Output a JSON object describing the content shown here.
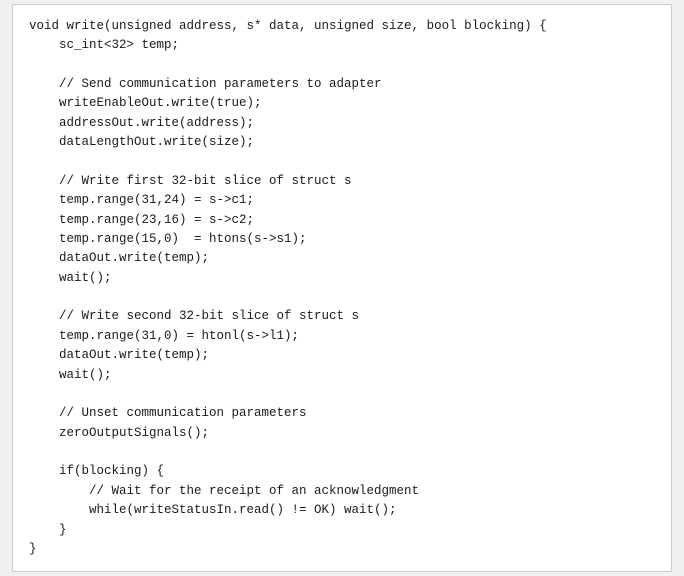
{
  "code": {
    "lines": [
      "void write(unsigned address, s* data, unsigned size, bool blocking) {",
      "    sc_int<32> temp;",
      "",
      "    // Send communication parameters to adapter",
      "    writeEnableOut.write(true);",
      "    addressOut.write(address);",
      "    dataLengthOut.write(size);",
      "",
      "    // Write first 32-bit slice of struct s",
      "    temp.range(31,24) = s->c1;",
      "    temp.range(23,16) = s->c2;",
      "    temp.range(15,0)  = htons(s->s1);",
      "    dataOut.write(temp);",
      "    wait();",
      "",
      "    // Write second 32-bit slice of struct s",
      "    temp.range(31,0) = htonl(s->l1);",
      "    dataOut.write(temp);",
      "    wait();",
      "",
      "    // Unset communication parameters",
      "    zeroOutputSignals();",
      "",
      "    if(blocking) {",
      "        // Wait for the receipt of an acknowledgment",
      "        while(writeStatusIn.read() != OK) wait();",
      "    }",
      "}"
    ]
  }
}
